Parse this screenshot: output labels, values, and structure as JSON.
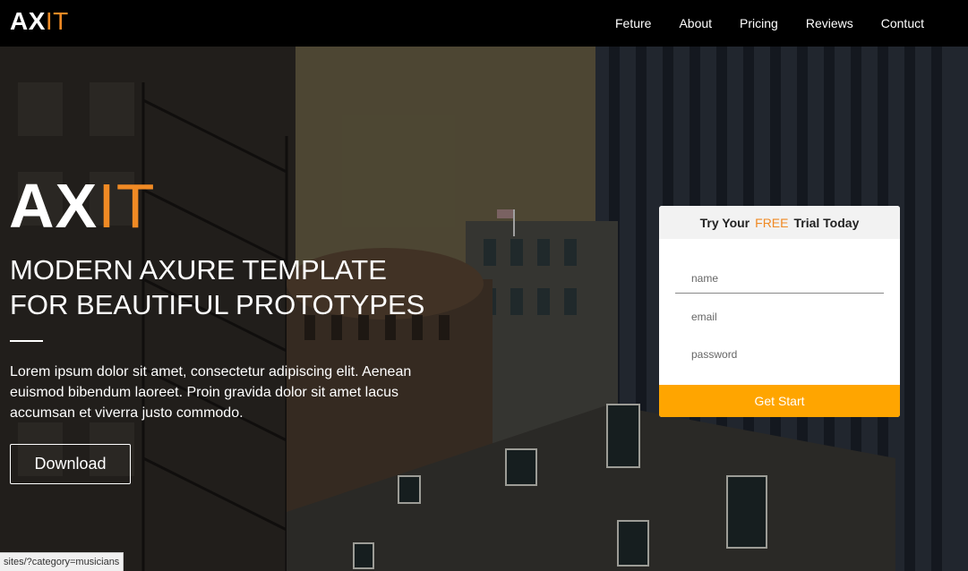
{
  "brand": {
    "logo_white": "AX",
    "logo_orange": "IT"
  },
  "nav": {
    "items": [
      "Feture",
      "About",
      "Pricing",
      "Reviews",
      "Contuct"
    ]
  },
  "hero": {
    "headline_line1": "MODERN AXURE TEMPLATE",
    "headline_line2": "FOR BEAUTIFUL PROTOTYPES",
    "lead": "Lorem ipsum dolor sit amet, consectetur adipiscing elit. Aenean euismod bibendum laoreet. Proin gravida dolor sit amet lacus accumsan et viverra justo commodo.",
    "download_label": "Download"
  },
  "form": {
    "title_pre": "Try Your",
    "title_free": "FREE",
    "title_post": "Trial Today",
    "name_placeholder": "name",
    "email_placeholder": "email",
    "password_placeholder": "password",
    "submit_label": "Get Start"
  },
  "status_url": "sites/?category=musicians",
  "colors": {
    "accent": "#f08a24",
    "button": "#ffa500",
    "topbar": "#000000"
  }
}
